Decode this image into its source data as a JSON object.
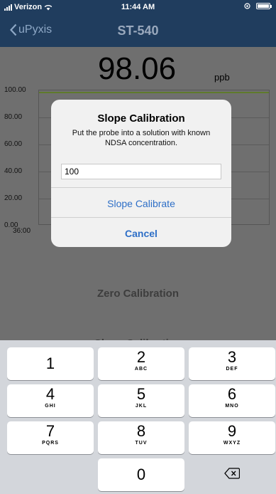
{
  "status": {
    "carrier": "Verizon",
    "time": "11:44 AM"
  },
  "nav": {
    "back_label": "uPyxis",
    "title": "ST-540"
  },
  "reading": {
    "value": "98.06",
    "unit": "ppb"
  },
  "chart_data": {
    "type": "line",
    "y_ticks": [
      "100.00",
      "80.00",
      "60.00",
      "40.00",
      "20.00",
      "0.00"
    ],
    "x_ticks": [
      "36:00"
    ],
    "ylim": [
      0,
      100
    ],
    "series": [
      {
        "values": [
          98,
          98
        ]
      }
    ],
    "grid": true
  },
  "background_buttons": {
    "zero_calibration": "Zero Calibration",
    "slope_calibration": "Slope Calibration"
  },
  "alert": {
    "title": "Slope Calibration",
    "message": "Put the probe into a solution with known NDSA concentration.",
    "input_value": "100",
    "primary_button": "Slope Calibrate",
    "cancel_button": "Cancel"
  },
  "keypad": {
    "keys": [
      {
        "num": "1",
        "letters": ""
      },
      {
        "num": "2",
        "letters": "ABC"
      },
      {
        "num": "3",
        "letters": "DEF"
      },
      {
        "num": "4",
        "letters": "GHI"
      },
      {
        "num": "5",
        "letters": "JKL"
      },
      {
        "num": "6",
        "letters": "MNO"
      },
      {
        "num": "7",
        "letters": "PQRS"
      },
      {
        "num": "8",
        "letters": "TUV"
      },
      {
        "num": "9",
        "letters": "WXYZ"
      },
      {
        "num": "0",
        "letters": ""
      }
    ],
    "backspace_icon": "backspace-icon"
  }
}
